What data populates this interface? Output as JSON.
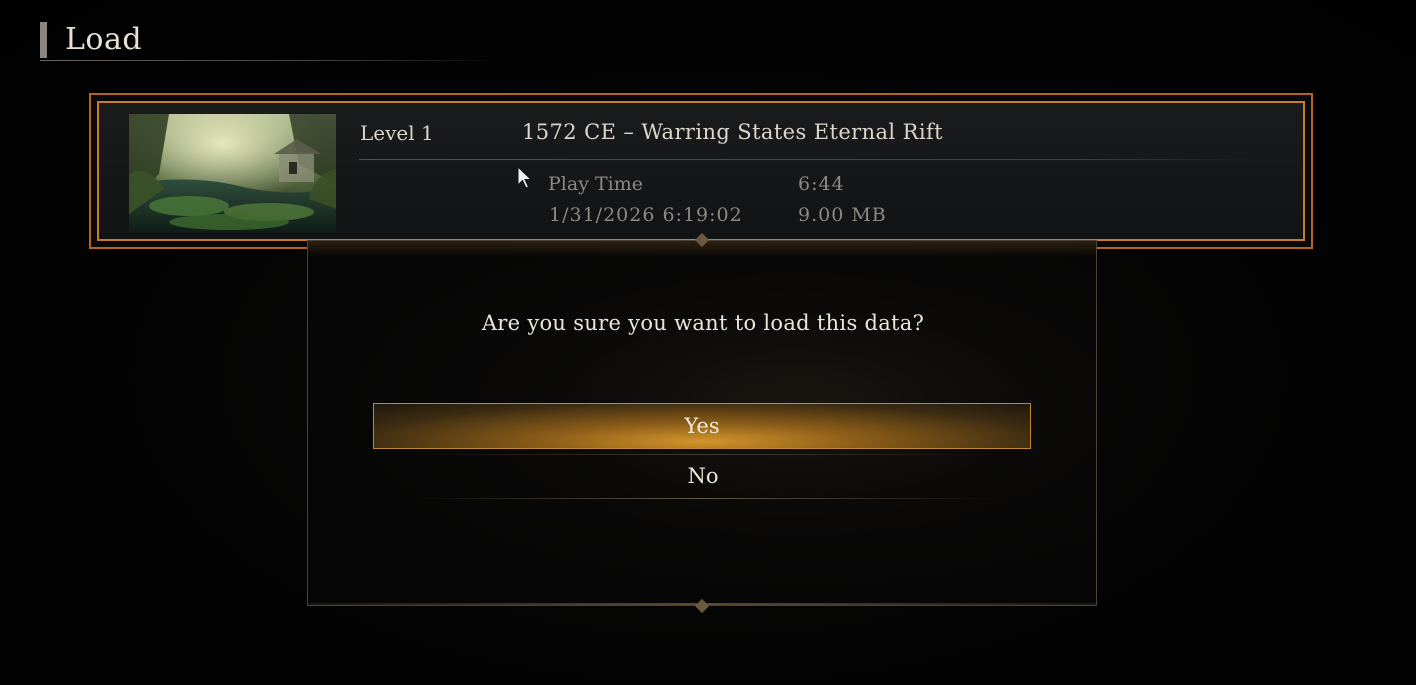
{
  "header": {
    "title": "Load"
  },
  "save_slot": {
    "level": "Level 1",
    "name": "1572 CE – Warring States Eternal Rift",
    "play_time_label": "Play Time",
    "play_time_value": "6:44",
    "date": "1/31/2026 6:19:02",
    "size": "9.00 MB",
    "thumbnail": "forest-ruins-thumbnail"
  },
  "dialog": {
    "message": "Are you sure you want to load this data?",
    "yes_label": "Yes",
    "no_label": "No",
    "selected": "Yes"
  },
  "colors": {
    "accent_border": "#c97a2a",
    "button_highlight": "#d3952b",
    "background": "#020202"
  }
}
